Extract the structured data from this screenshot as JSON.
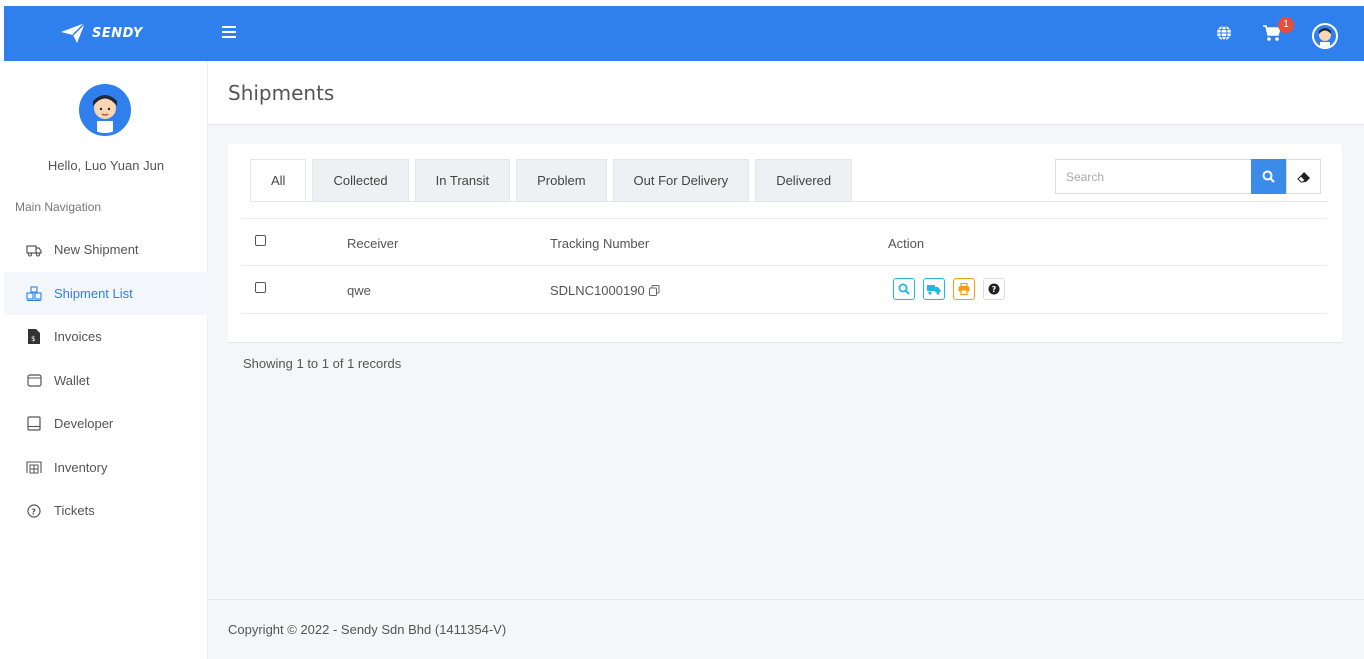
{
  "brand": {
    "name": "SENDY"
  },
  "topbar": {
    "cart_count": "1"
  },
  "sidebar": {
    "greeting": "Hello, Luo Yuan Jun",
    "section_label": "Main Navigation",
    "items": [
      {
        "label": "New Shipment",
        "icon": "truck-icon"
      },
      {
        "label": "Shipment List",
        "icon": "boxes-icon",
        "active": true
      },
      {
        "label": "Invoices",
        "icon": "invoice-icon"
      },
      {
        "label": "Wallet",
        "icon": "wallet-icon"
      },
      {
        "label": "Developer",
        "icon": "book-icon"
      },
      {
        "label": "Inventory",
        "icon": "warehouse-icon"
      },
      {
        "label": "Tickets",
        "icon": "question-circle-icon"
      }
    ]
  },
  "page": {
    "title": "Shipments"
  },
  "tabs": [
    {
      "label": "All",
      "active": true
    },
    {
      "label": "Collected"
    },
    {
      "label": "In Transit"
    },
    {
      "label": "Problem"
    },
    {
      "label": "Out For Delivery"
    },
    {
      "label": "Delivered"
    }
  ],
  "search": {
    "placeholder": "Search",
    "value": ""
  },
  "table": {
    "headers": {
      "receiver": "Receiver",
      "tracking": "Tracking Number",
      "action": "Action"
    },
    "rows": [
      {
        "receiver": "qwe",
        "tracking": "SDLNC1000190"
      }
    ]
  },
  "records_info": "Showing 1 to 1 of 1 records",
  "footer": {
    "copyright": "Copyright © 2022 - Sendy Sdn Bhd (1411354-V)"
  },
  "colors": {
    "primary": "#2f80ed",
    "info": "#23b7e5",
    "warning": "#f39c12",
    "danger": "#e74c3c"
  }
}
